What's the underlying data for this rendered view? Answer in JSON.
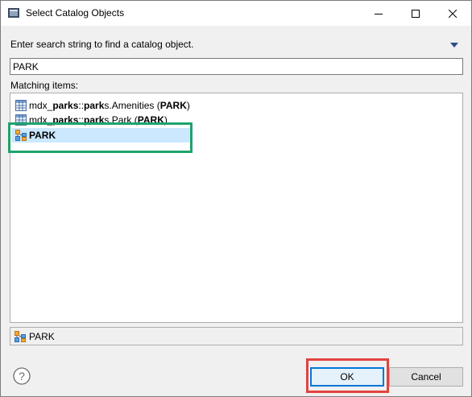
{
  "window": {
    "title": "Select Catalog Objects",
    "minimize_icon": "minimize-icon",
    "maximize_icon": "maximize-icon",
    "close_icon": "close-icon"
  },
  "prompt": "Enter search string to find a catalog object.",
  "search": {
    "value": "PARK",
    "placeholder": ""
  },
  "matching_label": "Matching items:",
  "items": [
    {
      "prefix": "mdx_",
      "bold1": "parks",
      "mid": "::",
      "bold2": "park",
      "suffix1": "s.Amenities (",
      "bold3": "PARK",
      "suffix2": ")",
      "icon": "table-icon"
    },
    {
      "prefix": "mdx_",
      "bold1": "parks",
      "mid": "::",
      "bold2": "park",
      "suffix1": "s.Park (",
      "bold3": "PARK",
      "suffix2": ")",
      "icon": "table-icon"
    },
    {
      "label": "PARK",
      "icon": "schema-icon",
      "selected": true
    }
  ],
  "status": {
    "text": "PARK",
    "icon": "schema-icon"
  },
  "buttons": {
    "ok": "OK",
    "cancel": "Cancel",
    "help_icon": "help-icon"
  },
  "annotation_colors": {
    "green": "#1fa36d",
    "red": "#e2433f",
    "selection": "#cce8ff"
  }
}
